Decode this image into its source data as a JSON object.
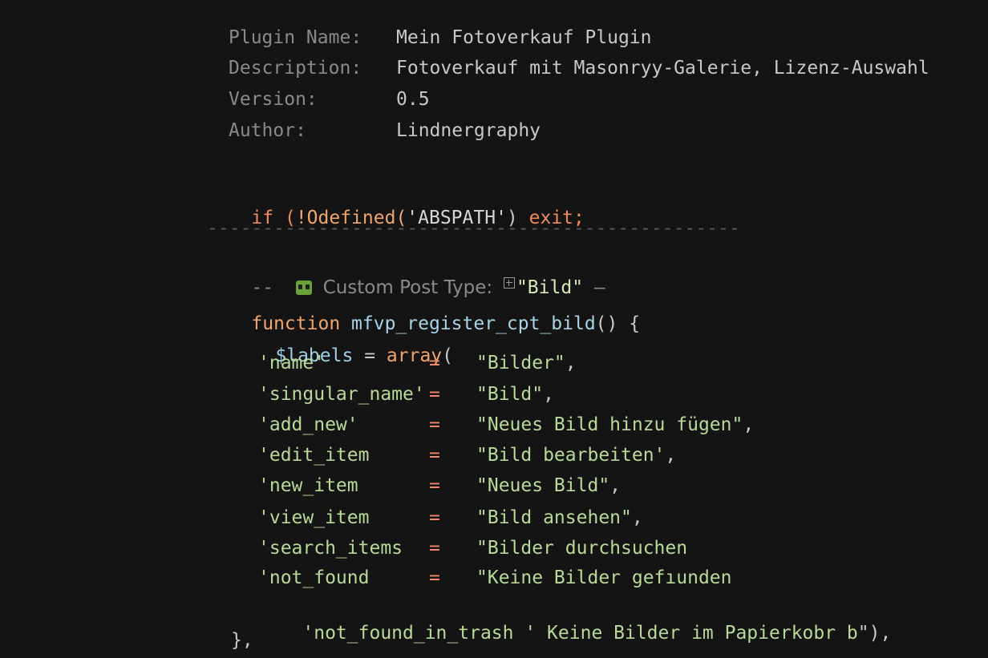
{
  "header": {
    "rows": [
      {
        "key": "Plugin Name:",
        "value": "Mein Fotoverkauf Plugin"
      },
      {
        "key": "Description:",
        "value": "Fotoverkauf mit Masonryy-Galerie, Lizenz-Auswahl"
      },
      {
        "key": "Version:",
        "value": "0.5"
      },
      {
        "key": "Author:",
        "value": "Lindnergraphy"
      }
    ]
  },
  "guard": {
    "if_kw": "if",
    "open_paren": "(",
    "call": "!Odefined",
    "arg_open": "(",
    "arg": "'ABSPATH'",
    "arg_close": ")",
    "exit": "exit;"
  },
  "separator": "------------------------------------------------",
  "section_comment": {
    "prefix": "--",
    "icon": "green-face-icon",
    "label": "Custom Post Type:",
    "type_icon": "box-plus-icon",
    "name": "\"Bild\"",
    "suffix": "–"
  },
  "function_decl": {
    "keyword": "function",
    "name": "mfvp_register_cpt_bild",
    "parens": "()",
    "brace": "{"
  },
  "labels_line": {
    "var": "$labels",
    "op": "=",
    "fn": "array",
    "paren": "("
  },
  "label_entries": [
    {
      "key": "'name'",
      "op": "=",
      "value": "\"Bilder\"",
      "tail": ","
    },
    {
      "key": "'singular_name'",
      "op": "=",
      "value": "\"Bild\"",
      "tail": ","
    },
    {
      "key": "'add_new'",
      "op": "=",
      "value": "\"Neues Bild hinzu fügen\"",
      "tail": ","
    },
    {
      "key": "'edit_item",
      "op": "=",
      "value": "\"Bild bearbeiten'",
      "tail": ","
    },
    {
      "key": "'new_item",
      "op": "=",
      "value": "\"Neues Bild\"",
      "tail": ","
    },
    {
      "key": "'view_item",
      "op": "=",
      "value": "\"Bild ansehen\"",
      "tail": ","
    },
    {
      "key": "'search_items",
      "op": "=",
      "value": "\"Bilder durchsuchen",
      "tail": ""
    },
    {
      "key": "'not_found",
      "op": "=",
      "value": "\"Keine Bilder gefıunden",
      "tail": ""
    }
  ],
  "trash_entry": {
    "key": "'not_found_in_trash",
    "value": "' Keine Bilder im Papierkobr b",
    "tail": "\"),"
  },
  "closing": "},",
  "colors": {
    "background": "#141414",
    "keyword": "#f08a5d",
    "string": "#b9d998",
    "function": "#a9d3e6",
    "comment": "#8a8a8a",
    "emoji_green": "#6aa23a"
  }
}
